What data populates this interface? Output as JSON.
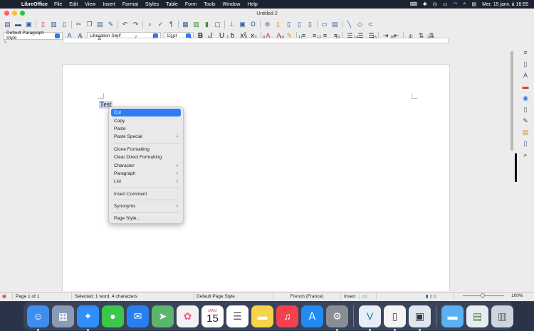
{
  "menubar": {
    "app_name": "LibreOffice",
    "items": [
      "File",
      "Edit",
      "View",
      "Insert",
      "Format",
      "Styles",
      "Table",
      "Form",
      "Tools",
      "Window",
      "Help"
    ],
    "clock": "Mer. 15 janv. à 16:55"
  },
  "window": {
    "title": "Untitled 2"
  },
  "formatting": {
    "paragraph_style": "Default Paragraph Style",
    "font_name": "Liberation Serif",
    "font_size": "12 pt"
  },
  "ruler": {
    "ticks": [
      "1",
      "1",
      "2",
      "3",
      "4",
      "5",
      "6",
      "7",
      "8",
      "9",
      "10",
      "11",
      "12",
      "13",
      "14",
      "15",
      "16",
      "17",
      "18"
    ]
  },
  "document": {
    "text": "Test"
  },
  "context_menu": {
    "items": [
      {
        "label": "Cut",
        "highlighted": true
      },
      {
        "label": "Copy"
      },
      {
        "label": "Paste"
      },
      {
        "label": "Paste Special",
        "submenu": true
      },
      {
        "label": "Clone Formatting"
      },
      {
        "label": "Clear Direct Formatting"
      },
      {
        "label": "Character",
        "submenu": true
      },
      {
        "label": "Paragraph",
        "submenu": true
      },
      {
        "label": "List",
        "submenu": true
      },
      {
        "label": "Insert Comment"
      },
      {
        "label": "Synonyms",
        "submenu": true
      },
      {
        "label": "Page Style..."
      }
    ]
  },
  "statusbar": {
    "page": "Page 1 of 1",
    "selection": "Selected: 1 word, 4 characters",
    "page_style": "Default Page Style",
    "language": "French (France)",
    "mode": "Insert",
    "zoom": "100%"
  },
  "dock": {
    "calendar_month": "JANV.",
    "calendar_day": "15"
  },
  "colors": {
    "accent": "#2e7cf6",
    "menubar": "#1d2230",
    "window": "#ececec"
  }
}
